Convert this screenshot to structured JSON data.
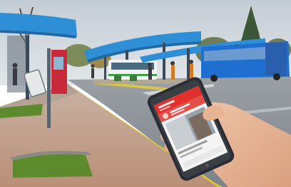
{
  "scene": {
    "subject": "hand-holding-smartphone-at-bus-station",
    "colors": {
      "sky": "#cfd6dc",
      "canopy": "#2e8fd6",
      "bus": "#1f6fd0",
      "road": "#8d9298",
      "sidewalk": "#c9a793",
      "grass": "#5e8a2e",
      "skin": "#e8b79a",
      "phone_body": "#2a2d33",
      "app_header": "#e2312b"
    }
  },
  "phone_screen": {
    "header_color": "#e2312b",
    "content_color": "#f4f4f4"
  }
}
